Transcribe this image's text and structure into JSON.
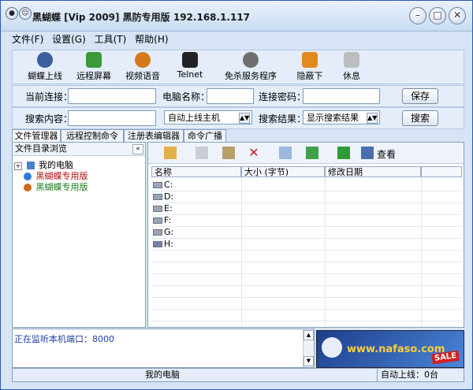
{
  "window": {
    "title": "黑蝴蝶 [Vip 2009] 黑防专用版 192.168.1.117",
    "minimize_icon": "minimize-icon",
    "maximize_icon": "maximize-icon",
    "close_icon": "close-icon"
  },
  "menu": [
    "文件(F)",
    "设置(G)",
    "工具(T)",
    "帮助(H)"
  ],
  "toolbar": [
    {
      "label": "蝴蝶上线",
      "icon": "butterfly-icon",
      "color": "#3b5f9e"
    },
    {
      "label": "远程屏幕",
      "icon": "screen-icon",
      "color": "#3a9a3a"
    },
    {
      "label": "视频语音",
      "icon": "video-icon",
      "color": "#d47a1a"
    },
    {
      "label": "Telnet",
      "icon": "terminal-icon",
      "color": "#222222"
    },
    {
      "label": "免杀服务程序",
      "icon": "service-icon",
      "color": "#6f6f6f"
    },
    {
      "label": "隐蔽下",
      "icon": "hide-icon",
      "color": "#e08a20"
    },
    {
      "label": "休息",
      "icon": "rest-icon",
      "color": "#9a9a9a"
    }
  ],
  "connection": {
    "current_label": "当前连接：",
    "current_value": "",
    "computer_label": "电脑名称：",
    "computer_value": "",
    "password_label": "连接密码：",
    "password_value": "",
    "save_label": "保存"
  },
  "search": {
    "content_label": "搜索内容：",
    "content_value": "",
    "host_select": "自动上线主机",
    "results_label": "搜索结果：",
    "results_select": "显示搜索结果",
    "search_label": "搜索"
  },
  "tabs": [
    "文件管理器",
    "远程控制命令",
    "注册表编辑器",
    "命令广播"
  ],
  "left_pane": {
    "header": "文件目录浏览",
    "collapse": "«",
    "items": [
      {
        "label": "我的电脑",
        "expander": "+"
      },
      {
        "label": "黑蝴蝶专用版"
      },
      {
        "label": "黑蝴蝶专用版"
      }
    ]
  },
  "file_toolbar": {
    "view_label": "查看"
  },
  "columns": [
    "名称",
    "大小 (字节)",
    "修改日期"
  ],
  "drives": [
    "C:",
    "D:",
    "E:",
    "F:",
    "G:",
    "H:"
  ],
  "log": {
    "text": "正在监听本机端口：8000"
  },
  "ad": {
    "site": "www.nafaso.com",
    "badge": "SALE"
  },
  "status": {
    "center": "我的电脑",
    "right": "自动上线：0台"
  }
}
